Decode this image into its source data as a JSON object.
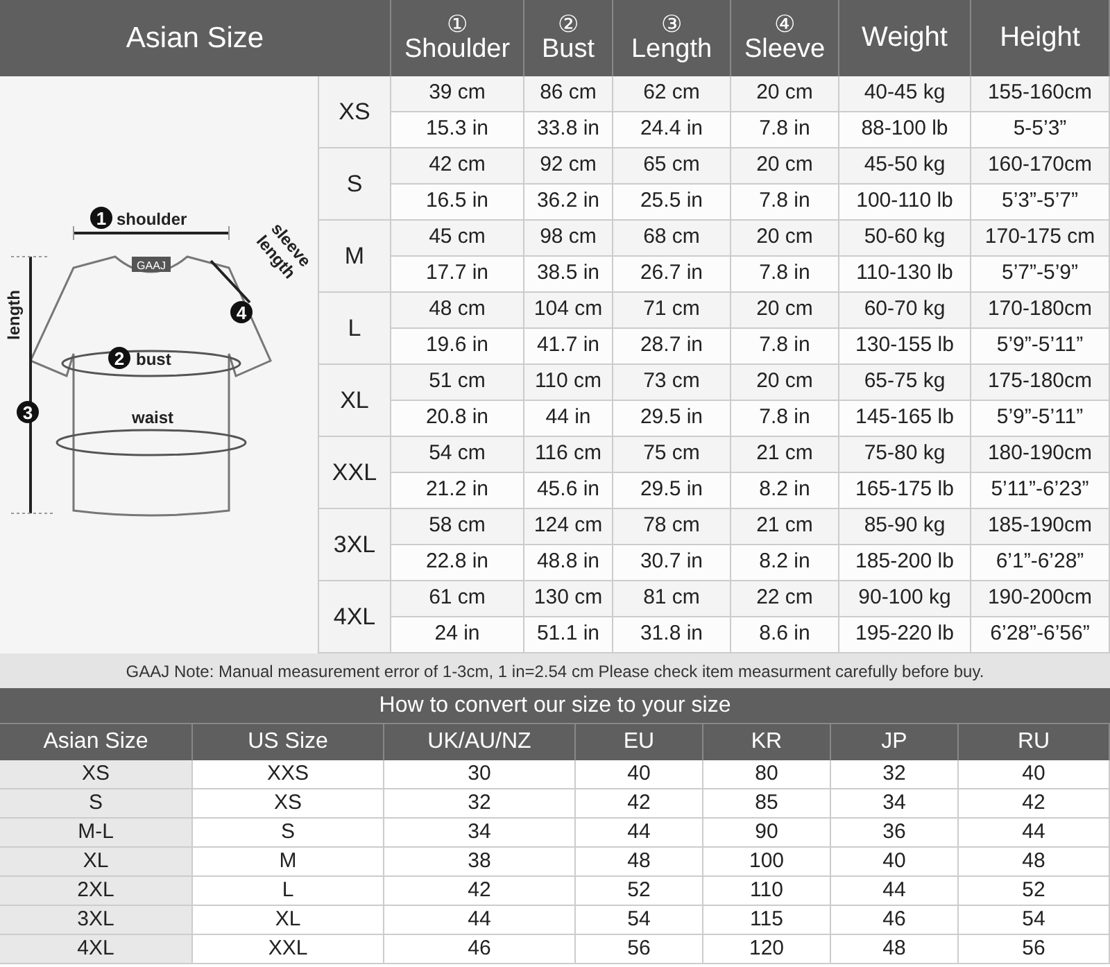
{
  "size_chart": {
    "title": "Asian Size",
    "columns": [
      {
        "number": "①",
        "label": "Shoulder"
      },
      {
        "number": "②",
        "label": "Bust"
      },
      {
        "number": "③",
        "label": "Length"
      },
      {
        "number": "④",
        "label": "Sleeve"
      },
      {
        "label": "Weight"
      },
      {
        "label": "Height"
      }
    ],
    "illustration": {
      "tag": "GAAJ",
      "waist_label": "waist",
      "markers": [
        {
          "number": "1",
          "lines": [
            "shoulder"
          ]
        },
        {
          "number": "2",
          "lines": [
            "bust"
          ]
        },
        {
          "number": "3",
          "lines": [
            "length"
          ]
        },
        {
          "number": "4",
          "lines": [
            "sleeve",
            "length"
          ]
        }
      ]
    },
    "sizes": [
      {
        "size": "XS",
        "rows": [
          [
            "39 cm",
            "86 cm",
            "62 cm",
            "20 cm",
            "40-45 kg",
            "155-160cm"
          ],
          [
            "15.3 in",
            "33.8 in",
            "24.4 in",
            "7.8 in",
            "88-100 lb",
            "5-5’3”"
          ]
        ]
      },
      {
        "size": "S",
        "rows": [
          [
            "42 cm",
            "92 cm",
            "65 cm",
            "20 cm",
            "45-50 kg",
            "160-170cm"
          ],
          [
            "16.5 in",
            "36.2 in",
            "25.5 in",
            "7.8 in",
            "100-110 lb",
            "5’3”-5’7”"
          ]
        ]
      },
      {
        "size": "M",
        "rows": [
          [
            "45 cm",
            "98 cm",
            "68 cm",
            "20 cm",
            "50-60 kg",
            "170-175 cm"
          ],
          [
            "17.7 in",
            "38.5 in",
            "26.7 in",
            "7.8 in",
            "110-130 lb",
            "5’7”-5’9”"
          ]
        ]
      },
      {
        "size": "L",
        "rows": [
          [
            "48 cm",
            "104 cm",
            "71 cm",
            "20 cm",
            "60-70 kg",
            "170-180cm"
          ],
          [
            "19.6 in",
            "41.7 in",
            "28.7 in",
            "7.8 in",
            "130-155 lb",
            "5’9”-5’11”"
          ]
        ]
      },
      {
        "size": "XL",
        "rows": [
          [
            "51 cm",
            "110 cm",
            "73 cm",
            "20 cm",
            "65-75 kg",
            "175-180cm"
          ],
          [
            "20.8 in",
            "44 in",
            "29.5 in",
            "7.8 in",
            "145-165 lb",
            "5’9”-5’11”"
          ]
        ]
      },
      {
        "size": "XXL",
        "rows": [
          [
            "54 cm",
            "116 cm",
            "75 cm",
            "21 cm",
            "75-80 kg",
            "180-190cm"
          ],
          [
            "21.2 in",
            "45.6 in",
            "29.5 in",
            "8.2 in",
            "165-175 lb",
            "5’11”-6’23”"
          ]
        ]
      },
      {
        "size": "3XL",
        "rows": [
          [
            "58 cm",
            "124 cm",
            "78 cm",
            "21 cm",
            "85-90 kg",
            "185-190cm"
          ],
          [
            "22.8 in",
            "48.8 in",
            "30.7 in",
            "8.2 in",
            "185-200 lb",
            "6’1”-6’28”"
          ]
        ]
      },
      {
        "size": "4XL",
        "rows": [
          [
            "61 cm",
            "130 cm",
            "81 cm",
            "22 cm",
            "90-100 kg",
            "190-200cm"
          ],
          [
            "24 in",
            "51.1 in",
            "31.8 in",
            "8.6 in",
            "195-220 lb",
            "6’28”-6’56”"
          ]
        ]
      }
    ]
  },
  "note": "GAAJ Note: Manual measurement error of 1-3cm, 1 in=2.54 cm Please check item measurment carefully before buy.",
  "conversion": {
    "title": "How to convert our size to your size",
    "columns": [
      "Asian Size",
      "US Size",
      "UK/AU/NZ",
      "EU",
      "KR",
      "JP",
      "RU"
    ],
    "rows": [
      [
        "XS",
        "XXS",
        "30",
        "40",
        "80",
        "32",
        "40"
      ],
      [
        "S",
        "XS",
        "32",
        "42",
        "85",
        "34",
        "42"
      ],
      [
        "M-L",
        "S",
        "34",
        "44",
        "90",
        "36",
        "44"
      ],
      [
        "XL",
        "M",
        "38",
        "48",
        "100",
        "40",
        "48"
      ],
      [
        "2XL",
        "L",
        "42",
        "52",
        "110",
        "44",
        "52"
      ],
      [
        "3XL",
        "XL",
        "44",
        "54",
        "115",
        "46",
        "54"
      ],
      [
        "4XL",
        "XXL",
        "46",
        "56",
        "120",
        "48",
        "56"
      ]
    ]
  }
}
